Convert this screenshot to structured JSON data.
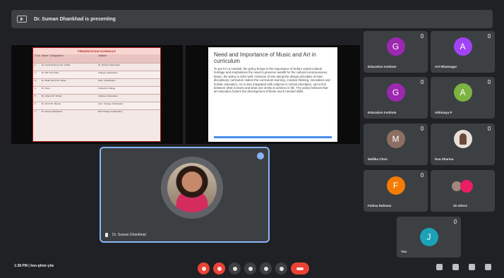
{
  "topbar": {
    "presenting_text": "Dr. Suman Dhankhad is presenting"
  },
  "slide_left": {
    "header": "PRESENTATION SCHEDULE",
    "col1": "S.No.",
    "col2": "Name / Designation",
    "col3": "Institute",
    "rows": [
      {
        "n": "1.",
        "name": "Dr. Kunal Sharma & Dr. Ankita",
        "inst": "Dr. School of Education"
      },
      {
        "n": "2.",
        "name": "Dr. Ritu & Dr. Ravi",
        "inst": "College of Education"
      },
      {
        "n": "3.",
        "name": "Dr. Swati Jain & Dr. Richa",
        "inst": "Dept. of Education"
      },
      {
        "n": "4.",
        "name": "Dr. Tanvi",
        "inst": "University College"
      },
      {
        "n": "5.",
        "name": "Dr. Asha & Dr. Mohan",
        "inst": "Institute of Education"
      },
      {
        "n": "6.",
        "name": "Dr. Anil & Dr. Meena",
        "inst": "Govt. College of Education"
      },
      {
        "n": "7.",
        "name": "Dr. Suman Dhankhad",
        "inst": "DAV College of Education"
      }
    ]
  },
  "slide_right": {
    "heading": "Need and Importance of Music and Art in curriculum",
    "bullet": "To put it in a nutshell, the policy brings in the importance of India's varied cultural heritage and emphasises the need to preserve wealth for the cultural consciousness. Music, the policy is strict well. Inclusion of arts along the design principles of inter-disciplinary curriculum makes the curriculum learning, creative thinking, innovation and holistic education. Art is also integrated with subjects in school education, and a link between what is learnt and what one seeks to achieve in life. The policy believes that art education fosters the development of these much needed skills."
  },
  "presenter": {
    "name": "Dr. Suman Dhankhad"
  },
  "participants": [
    {
      "initial": "G",
      "name": "Education Institute",
      "color": "#9c27b0"
    },
    {
      "initial": "A",
      "name": "Arti Bhatnagar",
      "color": "#a142f4"
    },
    {
      "initial": "G",
      "name": "Education Institute",
      "color": "#9c27b0"
    },
    {
      "initial": "A",
      "name": "Abhinaya P",
      "color": "#7cb342"
    },
    {
      "initial": "M",
      "name": "Mallika Chon",
      "color": "#8d6e63"
    },
    {
      "initial": "",
      "name": "Dua Sharma",
      "color": "#e8e0d8"
    },
    {
      "initial": "F",
      "name": "Fatima Rahman",
      "color": "#f57c00"
    },
    {
      "initial": "",
      "name": "15 others",
      "color": "#5f6368"
    },
    {
      "initial": "J",
      "name": "You",
      "color": "#1ba1b8"
    }
  ],
  "bottombar": {
    "clock": "1:38 PM | bsn-qhmr-ybe"
  }
}
